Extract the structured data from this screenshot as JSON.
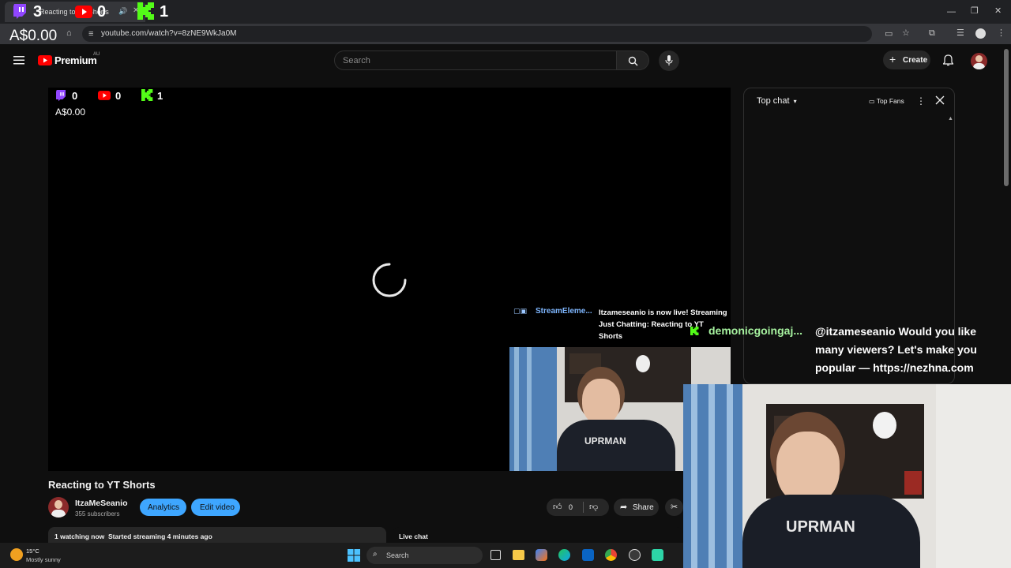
{
  "browser": {
    "tab_title": "Reacting to YT Shorts",
    "url": "youtube.com/watch?v=8zNE9WkJa0M"
  },
  "overlay_top": {
    "twitch_count": "3",
    "youtube_count": "0",
    "kick_count": "1",
    "donation_amount": "A$0.00"
  },
  "overlay_player": {
    "twitch_count": "0",
    "youtube_count": "0",
    "kick_count": "1",
    "donation_amount": "A$0.00"
  },
  "header": {
    "logo_text": "Premium",
    "region": "AU",
    "search_placeholder": "Search",
    "create_label": "Create"
  },
  "video": {
    "title": "Reacting to YT Shorts",
    "channel_name": "ItzaMeSeanio",
    "subscribers": "355 subscribers",
    "analytics_label": "Analytics",
    "edit_label": "Edit video",
    "likes": "0",
    "share_label": "Share",
    "status": "1 watching now  Started streaming 4 minutes ago"
  },
  "chat": {
    "mode_label": "Top chat",
    "top_fans_label": "Top Fans",
    "live_chat_label": "Live chat"
  },
  "alerts": {
    "streamelements_name": "StreamEleme...",
    "live_message": "Itzameseanio is now live! Streaming Just Chatting: Reacting to YT Shorts",
    "chat_user": "demonicgoingaj...",
    "chat_message": "@itzameseanio Would you like many viewers? Let's make you popular — https://nezhna.com"
  },
  "taskbar": {
    "temperature": "15°C",
    "weather": "Mostly sunny",
    "search_label": "Search"
  },
  "colors": {
    "youtube_red": "#ff0000",
    "twitch_purple": "#9146ff",
    "kick_green": "#53fc18",
    "button_blue": "#3ea6ff",
    "chat_user_green": "#a7f3a0"
  }
}
